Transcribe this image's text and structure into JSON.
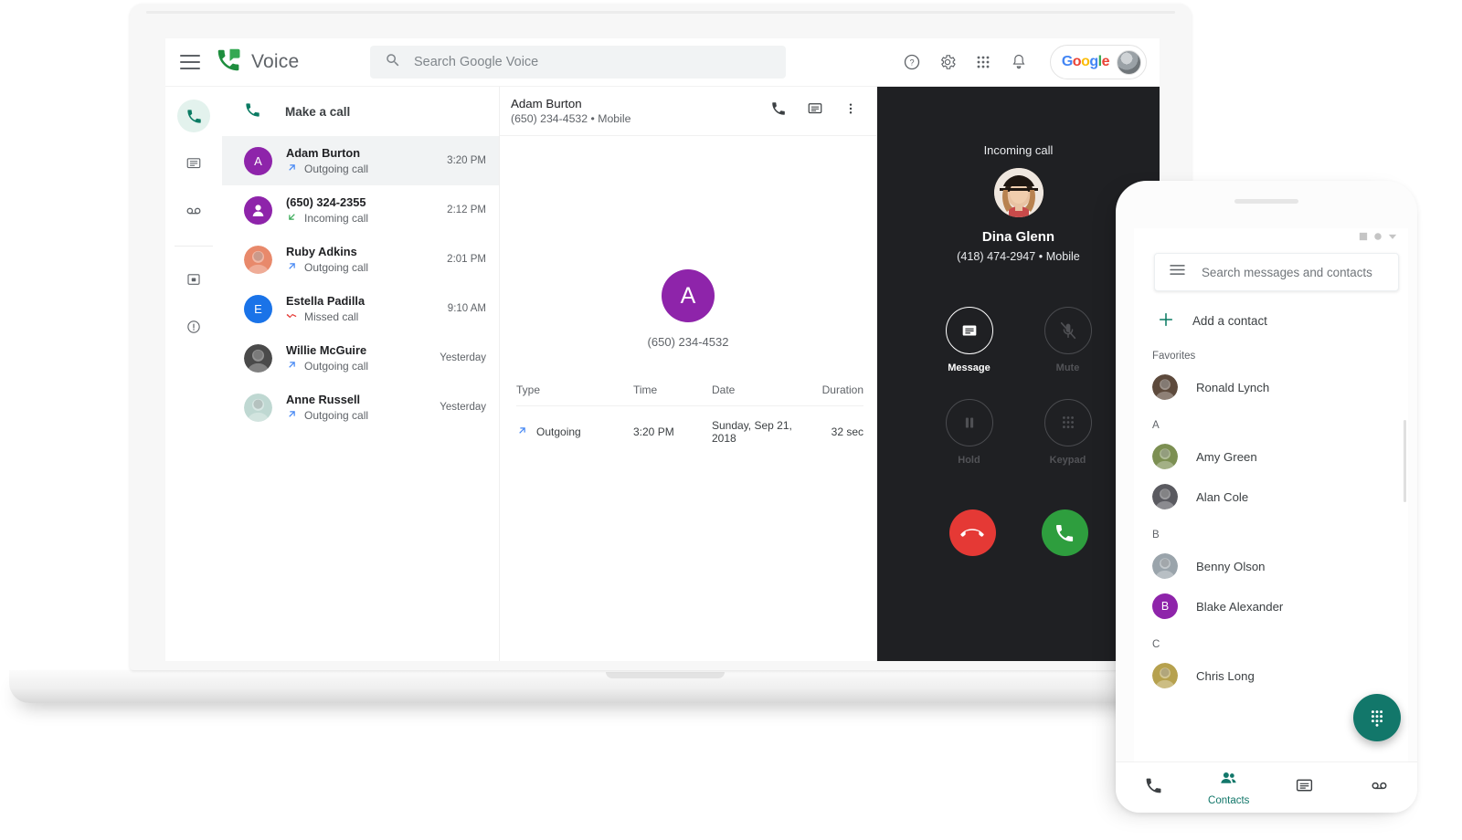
{
  "app": {
    "brand_name": "Voice",
    "menu_icon": "hamburger-icon",
    "logo_icon": "google-voice-logo-icon"
  },
  "search": {
    "placeholder": "Search Google Voice",
    "icon": "search-icon"
  },
  "header_actions": [
    {
      "name": "help-icon",
      "glyph": "?"
    },
    {
      "name": "settings-gear-icon",
      "glyph": "gear"
    },
    {
      "name": "apps-grid-icon",
      "glyph": "grid"
    },
    {
      "name": "notifications-bell-icon",
      "glyph": "bell"
    }
  ],
  "account_chip": {
    "logo_letters": [
      "G",
      "o",
      "o",
      "g",
      "l",
      "e"
    ],
    "avatar": "user-avatar"
  },
  "rail": [
    {
      "name": "calls",
      "icon": "phone-icon",
      "active": true
    },
    {
      "name": "messages",
      "icon": "message-icon",
      "active": false
    },
    {
      "name": "voicemail",
      "icon": "voicemail-icon",
      "active": false
    },
    {
      "name": "archive",
      "icon": "archive-icon",
      "active": false
    },
    {
      "name": "info",
      "icon": "info-icon",
      "active": false
    }
  ],
  "make_call": {
    "label": "Make a call",
    "icon": "phone-icon"
  },
  "call_list": [
    {
      "name": "Adam Burton",
      "status": "Outgoing call",
      "direction": "outgoing",
      "time": "3:20 PM",
      "avatar_type": "initial",
      "initial": "A",
      "color": "#8e24aa",
      "selected": true
    },
    {
      "name": "(650) 324-2355",
      "status": "Incoming call",
      "direction": "incoming",
      "time": "2:12 PM",
      "avatar_type": "person",
      "initial": "",
      "color": "#8e24aa",
      "selected": false
    },
    {
      "name": "Ruby Adkins",
      "status": "Outgoing call",
      "direction": "outgoing",
      "time": "2:01 PM",
      "avatar_type": "photo",
      "initial": "",
      "color": "#e8896b",
      "selected": false
    },
    {
      "name": "Estella Padilla",
      "status": "Missed call",
      "direction": "missed",
      "time": "9:10 AM",
      "avatar_type": "initial",
      "initial": "E",
      "color": "#1a73e8",
      "selected": false
    },
    {
      "name": "Willie McGuire",
      "status": "Outgoing call",
      "direction": "outgoing",
      "time": "Yesterday",
      "avatar_type": "photo",
      "initial": "",
      "color": "#4a4a4a",
      "selected": false
    },
    {
      "name": "Anne Russell",
      "status": "Outgoing call",
      "direction": "outgoing",
      "time": "Yesterday",
      "avatar_type": "photo",
      "initial": "",
      "color": "#bfd8d2",
      "selected": false
    }
  ],
  "detail": {
    "name": "Adam Burton",
    "number_line": "(650) 234-4532 • Mobile",
    "big_initial": "A",
    "big_color": "#8e24aa",
    "big_number": "(650) 234-4532",
    "actions": [
      {
        "name": "call-button",
        "icon": "phone-icon"
      },
      {
        "name": "message-button",
        "icon": "message-icon"
      },
      {
        "name": "more-options-button",
        "icon": "more-vert-icon"
      }
    ],
    "history_headers": {
      "type": "Type",
      "time": "Time",
      "date": "Date",
      "duration": "Duration"
    },
    "history_rows": [
      {
        "type": "Outgoing",
        "direction": "outgoing",
        "time": "3:20 PM",
        "date": "Sunday, Sep 21, 2018",
        "duration": "32 sec"
      }
    ]
  },
  "incoming_call": {
    "label": "Incoming call",
    "caller_name": "Dina Glenn",
    "caller_number": "(418) 474-2947 • Mobile",
    "controls": [
      {
        "label": "Message",
        "icon": "message-icon",
        "enabled": true
      },
      {
        "label": "Mute",
        "icon": "mic-off-icon",
        "enabled": false
      },
      {
        "label": "Hold",
        "icon": "pause-icon",
        "enabled": false
      },
      {
        "label": "Keypad",
        "icon": "dialpad-icon",
        "enabled": false
      }
    ],
    "decline": {
      "name": "decline-call-button",
      "icon": "call-end-icon",
      "color": "#e53935"
    },
    "answer": {
      "name": "answer-call-button",
      "icon": "phone-icon",
      "color": "#2e9e3e"
    }
  },
  "phone": {
    "search_placeholder": "Search messages and contacts",
    "search_menu_icon": "hamburger-icon",
    "add_contact": {
      "label": "Add a contact",
      "icon": "plus-icon"
    },
    "sections": [
      {
        "label": "Favorites",
        "contacts": [
          {
            "name": "Ronald Lynch",
            "avatar_type": "photo",
            "initial": "",
            "color": "#5d4a3c"
          }
        ]
      },
      {
        "label": "A",
        "contacts": [
          {
            "name": "Amy Green",
            "avatar_type": "photo",
            "initial": "",
            "color": "#7c8f52"
          },
          {
            "name": "Alan Cole",
            "avatar_type": "photo",
            "initial": "",
            "color": "#5a5a60"
          }
        ]
      },
      {
        "label": "B",
        "contacts": [
          {
            "name": "Benny Olson",
            "avatar_type": "photo",
            "initial": "",
            "color": "#9aa4ab"
          },
          {
            "name": "Blake Alexander",
            "avatar_type": "initial",
            "initial": "B",
            "color": "#8e24aa"
          }
        ]
      },
      {
        "label": "C",
        "contacts": [
          {
            "name": "Chris Long",
            "avatar_type": "photo",
            "initial": "",
            "color": "#b6a14e"
          }
        ]
      }
    ],
    "fab": {
      "name": "dialpad-fab",
      "icon": "dialpad-icon",
      "color": "#12776a"
    },
    "nav": [
      {
        "label": "",
        "name": "calls",
        "icon": "phone-icon",
        "active": false
      },
      {
        "label": "Contacts",
        "name": "contacts",
        "icon": "contacts-icon",
        "active": true
      },
      {
        "label": "",
        "name": "messages",
        "icon": "message-icon",
        "active": false
      },
      {
        "label": "",
        "name": "voicemail",
        "icon": "voicemail-icon",
        "active": false
      }
    ]
  },
  "colors": {
    "accent_teal": "#12776a",
    "voice_green": "#1e8e3e",
    "selected_row": "#f1f3f4",
    "dark_panel": "#1f2023",
    "missed_red": "#e53935",
    "outgoing_blue": "#4285f4",
    "incoming_green": "#34a853"
  }
}
